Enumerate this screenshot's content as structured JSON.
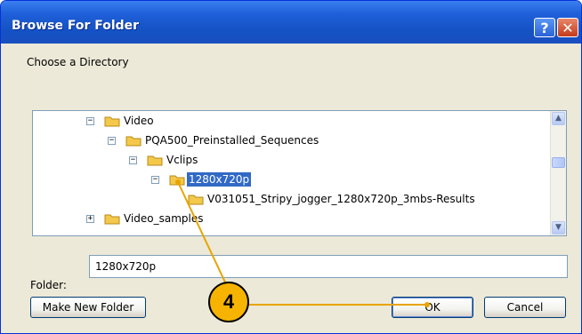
{
  "window": {
    "title": "Browse For Folder",
    "help_glyph": "?",
    "close_glyph": "✕"
  },
  "prompt": "Choose a Directory",
  "tree": {
    "nodes": [
      {
        "label": "Video",
        "expander": "−",
        "selected": false
      },
      {
        "label": "PQA500_Preinstalled_Sequences",
        "expander": "−",
        "selected": false
      },
      {
        "label": "Vclips",
        "expander": "−",
        "selected": false
      },
      {
        "label": "1280x720p",
        "expander": "−",
        "selected": true
      },
      {
        "label": "V031051_Stripy_jogger_1280x720p_3mbs-Results",
        "expander": "",
        "selected": false
      },
      {
        "label": "Video_samples",
        "expander": "+",
        "selected": false
      }
    ],
    "scroll_up_glyph": "▲",
    "scroll_down_glyph": "▼"
  },
  "folder": {
    "label": "Folder:",
    "value": "1280x720p"
  },
  "buttons": {
    "make_new_folder": "Make New Folder",
    "ok": "OK",
    "cancel": "Cancel"
  },
  "callout": {
    "number": "4",
    "color": "#f6b400"
  },
  "colors": {
    "titlebar": "#1f5fd8",
    "selection": "#316ac5",
    "folder_icon": "#f3c84b"
  }
}
